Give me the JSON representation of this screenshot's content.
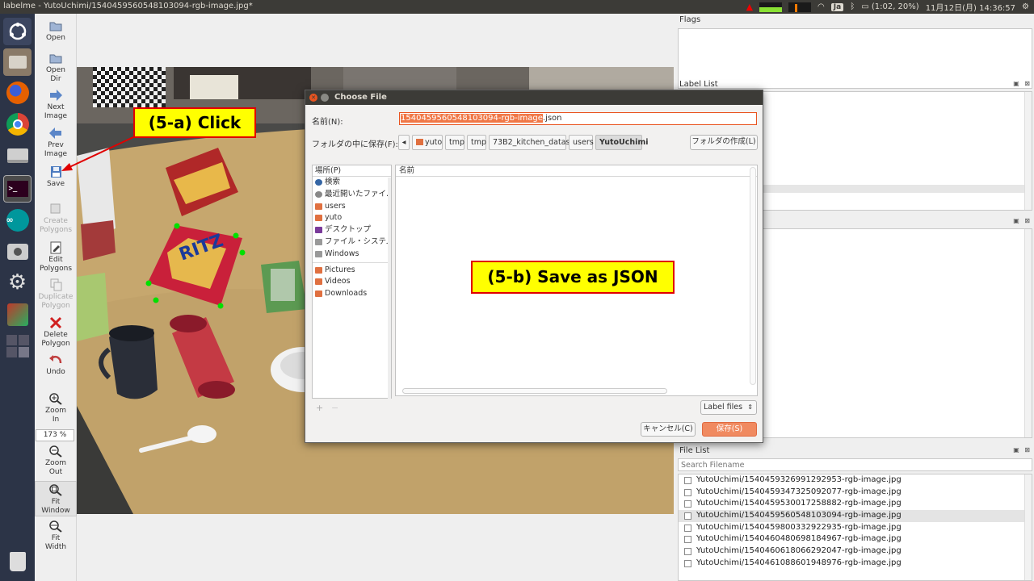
{
  "window": {
    "title": "labelme - YutoUchimi/1540459560548103094-rgb-image.jpg*"
  },
  "tray": {
    "ime": "Ja",
    "battery": "(1:02, 20%)",
    "clock": "11月12日(月) 14:36:57"
  },
  "launcher": {
    "items": [
      "ubuntu-dash",
      "file-manager",
      "firefox",
      "chrome",
      "drive",
      "terminal",
      "arduino",
      "screenshot",
      "settings",
      "image-app",
      "workspace-switcher",
      "trash"
    ]
  },
  "toolbar": {
    "open": "Open",
    "open_dir": [
      "Open",
      "Dir"
    ],
    "next_image": [
      "Next",
      "Image"
    ],
    "prev_image": [
      "Prev",
      "Image"
    ],
    "save": "Save",
    "create_polygons": [
      "Create",
      "Polygons"
    ],
    "edit_polygons": [
      "Edit",
      "Polygons"
    ],
    "duplicate_polygon": [
      "Duplicate",
      "Polygon"
    ],
    "delete_polygon": [
      "Delete",
      "Polygon"
    ],
    "undo": "Undo",
    "zoom_in": [
      "Zoom",
      "In"
    ],
    "zoom_value": "173 %",
    "zoom_out": [
      "Zoom",
      "Out"
    ],
    "fit_window": [
      "Fit",
      "Window"
    ],
    "fit_width": [
      "Fit",
      "Width"
    ]
  },
  "dock": {
    "flags_title": "Flags",
    "label_list_title": "Label List",
    "file_list_title": "File List",
    "search_placeholder": "Search Filename",
    "files": [
      {
        "name": "YutoUchimi/1540459326991292953-rgb-image.jpg",
        "selected": false
      },
      {
        "name": "YutoUchimi/1540459347325092077-rgb-image.jpg",
        "selected": false
      },
      {
        "name": "YutoUchimi/1540459530017258882-rgb-image.jpg",
        "selected": false
      },
      {
        "name": "YutoUchimi/1540459560548103094-rgb-image.jpg",
        "selected": true
      },
      {
        "name": "YutoUchimi/1540459800332922935-rgb-image.jpg",
        "selected": false
      },
      {
        "name": "YutoUchimi/1540460480698184967-rgb-image.jpg",
        "selected": false
      },
      {
        "name": "YutoUchimi/1540460618066292047-rgb-image.jpg",
        "selected": false
      },
      {
        "name": "YutoUchimi/1540461088601948976-rgb-image.jpg",
        "selected": false
      }
    ]
  },
  "dialog": {
    "title": "Choose File",
    "name_label": "名前(N):",
    "name_value_selected": "1540459560548103094-rgb-image",
    "name_value_ext": ".json",
    "folder_label": "フォルダの中に保存(F):",
    "breadcrumbs": [
      "yuto",
      "tmp",
      "tmp",
      "73B2_kitchen_dataset",
      "users",
      "YutoUchimi"
    ],
    "create_folder": "フォルダの作成(L)",
    "places_header": "場所(P)",
    "places": [
      {
        "label": "検索",
        "icon": "search-icon"
      },
      {
        "label": "最近開いたファイ...",
        "icon": "recent-icon"
      },
      {
        "label": "users",
        "icon": "folder-icon"
      },
      {
        "label": "yuto",
        "icon": "home-folder-icon"
      },
      {
        "label": "デスクトップ",
        "icon": "desktop-icon"
      },
      {
        "label": "ファイル・システム",
        "icon": "drive-icon"
      },
      {
        "label": "Windows",
        "icon": "drive-icon"
      },
      {
        "label": "Pictures",
        "icon": "folder-icon"
      },
      {
        "label": "Videos",
        "icon": "folder-icon"
      },
      {
        "label": "Downloads",
        "icon": "folder-icon"
      }
    ],
    "filelist_header": "名前",
    "filter": "Label files",
    "cancel": "キャンセル(C)",
    "save": "保存(S)"
  },
  "annotations": {
    "click": "(5-a) Click",
    "save_json": "(5-b) Save as JSON"
  },
  "colors": {
    "accent": "#e95420",
    "launcher_bg": "#2c3447",
    "panel_bg": "#3c3b37",
    "callout_fill": "#ffff00",
    "callout_border": "#e00000",
    "polygon_vertex": "#00e000"
  }
}
